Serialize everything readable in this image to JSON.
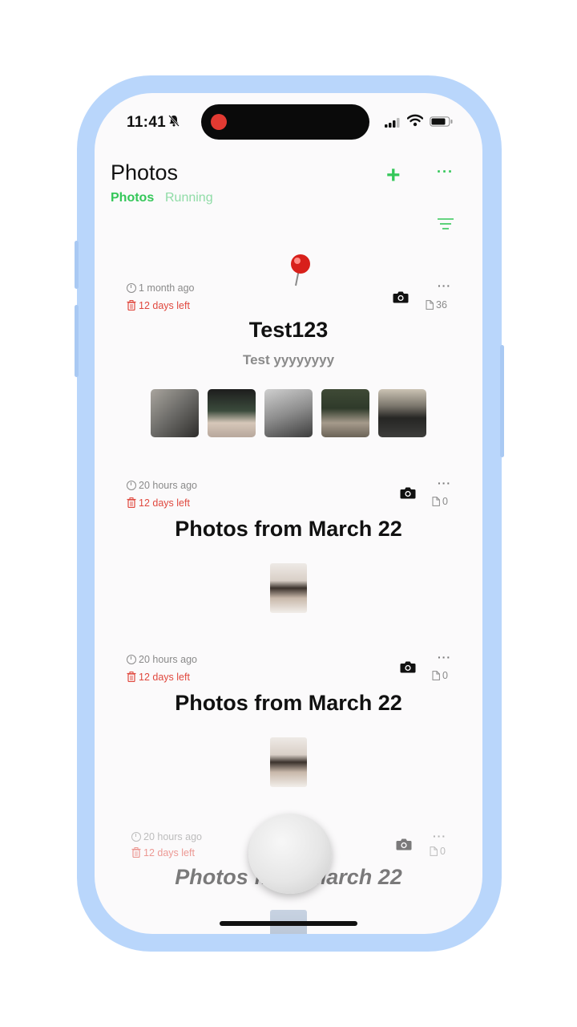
{
  "status_bar": {
    "time": "11:41"
  },
  "nav": {
    "title": "Photos",
    "tabs": [
      {
        "label": "Photos"
      },
      {
        "label": "Running"
      }
    ],
    "add_icon": "plus-icon",
    "more_icon": "ellipsis-icon",
    "filter_icon": "filter-lines-icon"
  },
  "cards": [
    {
      "pinned": true,
      "created": "1 month ago",
      "expires": "12 days left",
      "count": "36",
      "title": "Test123",
      "subtitle": "Test yyyyyyyy",
      "thumbnail_count": 5
    },
    {
      "created": "20 hours ago",
      "expires": "12 days left",
      "count": "0",
      "title": "Photos from March 22",
      "thumbnail_count": 1
    },
    {
      "created": "20 hours ago",
      "expires": "12 days left",
      "count": "0",
      "title": "Photos from March 22",
      "thumbnail_count": 1
    },
    {
      "created": "20 hours ago",
      "expires": "12 days left",
      "count": "0",
      "title": "Photos from March 22",
      "thumbnail_count": 1
    }
  ],
  "colors": {
    "accent": "#34c759",
    "danger": "#e0483e",
    "frame": "#b9d6fb"
  }
}
